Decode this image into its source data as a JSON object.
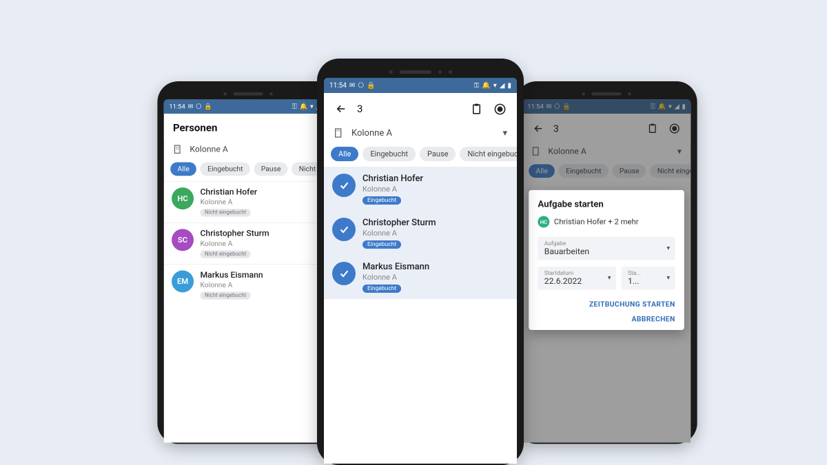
{
  "status": {
    "time": "11:54"
  },
  "filters": {
    "all": "Alle",
    "booked": "Eingebucht",
    "pause": "Pause",
    "notbooked": "Nicht eingebucht"
  },
  "group_label": "Kolonne A",
  "badge_notbooked": "Nicht eingebucht",
  "badge_booked": "Eingebucht",
  "left": {
    "title": "Personen",
    "people": [
      {
        "initials": "HC",
        "color": "#3aa85d",
        "name": "Christian Hofer",
        "group": "Kolonne A"
      },
      {
        "initials": "SC",
        "color": "#a54cc0",
        "name": "Christopher Sturm",
        "group": "Kolonne A"
      },
      {
        "initials": "EM",
        "color": "#3a9dd8",
        "name": "Markus Eismann",
        "group": "Kolonne A"
      }
    ]
  },
  "center": {
    "count": "3",
    "people": [
      {
        "name": "Christian Hofer",
        "group": "Kolonne A"
      },
      {
        "name": "Christopher Sturm",
        "group": "Kolonne A"
      },
      {
        "name": "Markus Eismann",
        "group": "Kolonne A"
      }
    ]
  },
  "right": {
    "count": "3",
    "modal": {
      "title": "Aufgabe starten",
      "who_initials": "HC",
      "who_text": "Christian Hofer + 2 mehr",
      "task_label": "Aufgabe",
      "task_value": "Bauarbeiten",
      "date_label": "Startdatum",
      "date_value": "22.6.2022",
      "time_label": "Sta...",
      "time_value": "1...",
      "action_start": "ZEITBUCHUNG STARTEN",
      "action_cancel": "ABBRECHEN"
    }
  }
}
